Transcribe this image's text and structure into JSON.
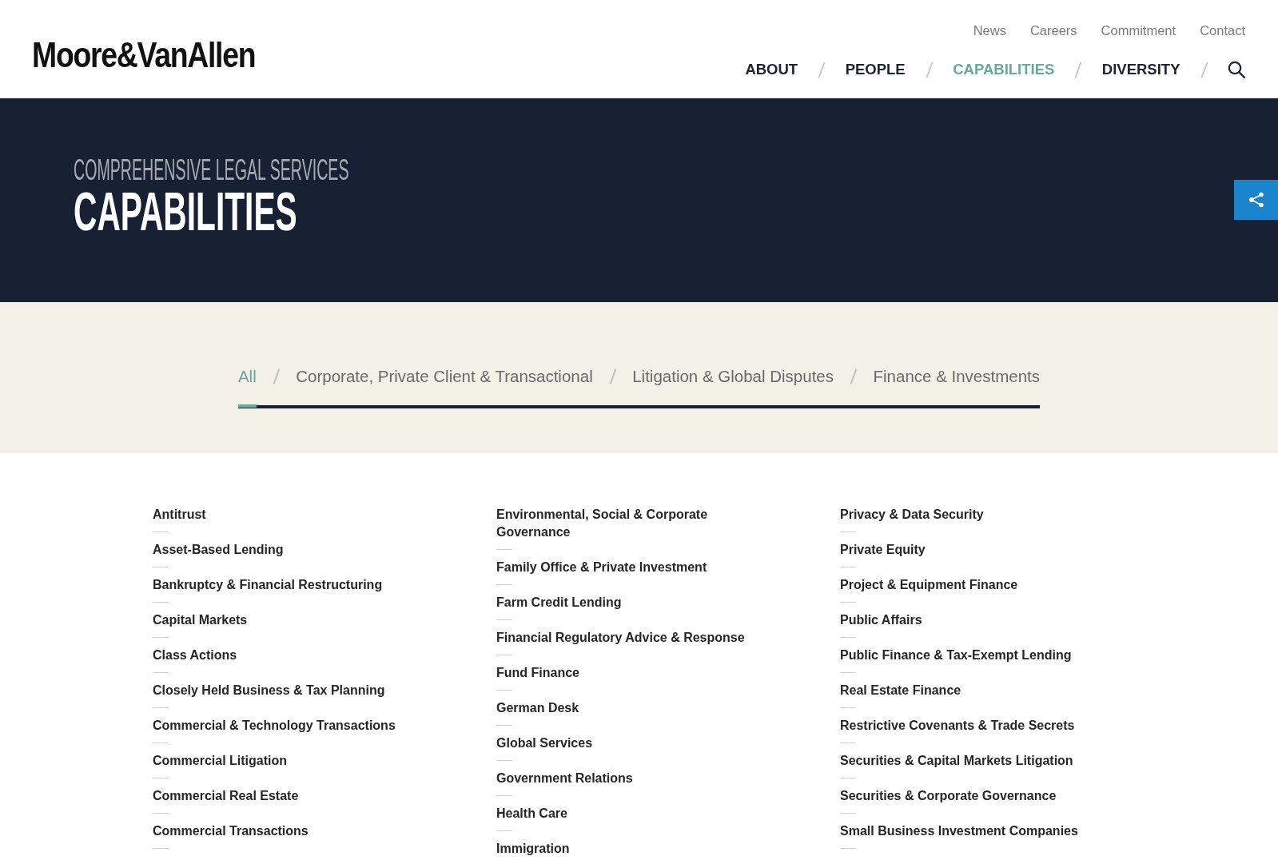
{
  "header": {
    "logo": "Moore&VanAllen",
    "utility_links": [
      "News",
      "Careers",
      "Commitment",
      "Contact"
    ],
    "nav": [
      {
        "label": "ABOUT",
        "selected": false
      },
      {
        "label": "PEOPLE",
        "selected": false
      },
      {
        "label": "CAPABILITIES",
        "selected": true
      },
      {
        "label": "DIVERSITY",
        "selected": false
      }
    ]
  },
  "hero": {
    "eyebrow": "COMPREHENSIVE LEGAL SERVICES",
    "title": "CAPABILITIES"
  },
  "filter_tabs": [
    {
      "label": "All",
      "selected": true
    },
    {
      "label": "Corporate, Private Client & Transactional",
      "selected": false
    },
    {
      "label": "Litigation & Global Disputes",
      "selected": false
    },
    {
      "label": "Finance & Investments",
      "selected": false
    }
  ],
  "capabilities": {
    "columns": [
      [
        "Antitrust",
        "Asset-Based Lending",
        "Bankruptcy & Financial Restructuring",
        "Capital Markets",
        "Class Actions",
        "Closely Held Business & Tax Planning",
        "Commercial & Technology Transactions",
        "Commercial Litigation",
        "Commercial Real Estate",
        "Commercial Transactions"
      ],
      [
        "Environmental, Social & Corporate Governance",
        "Family Office & Private Investment",
        "Farm Credit Lending",
        "Financial Regulatory Advice & Response",
        "Fund Finance",
        "German Desk",
        "Global Services",
        "Government Relations",
        "Health Care",
        "Immigration"
      ],
      [
        "Privacy & Data Security",
        "Private Equity",
        "Project & Equipment Finance",
        "Public Affairs",
        "Public Finance & Tax-Exempt Lending",
        "Real Estate Finance",
        "Restrictive Covenants & Trade Secrets",
        "Securities & Capital Markets Litigation",
        "Securities & Corporate Governance",
        "Small Business Investment Companies"
      ]
    ]
  }
}
